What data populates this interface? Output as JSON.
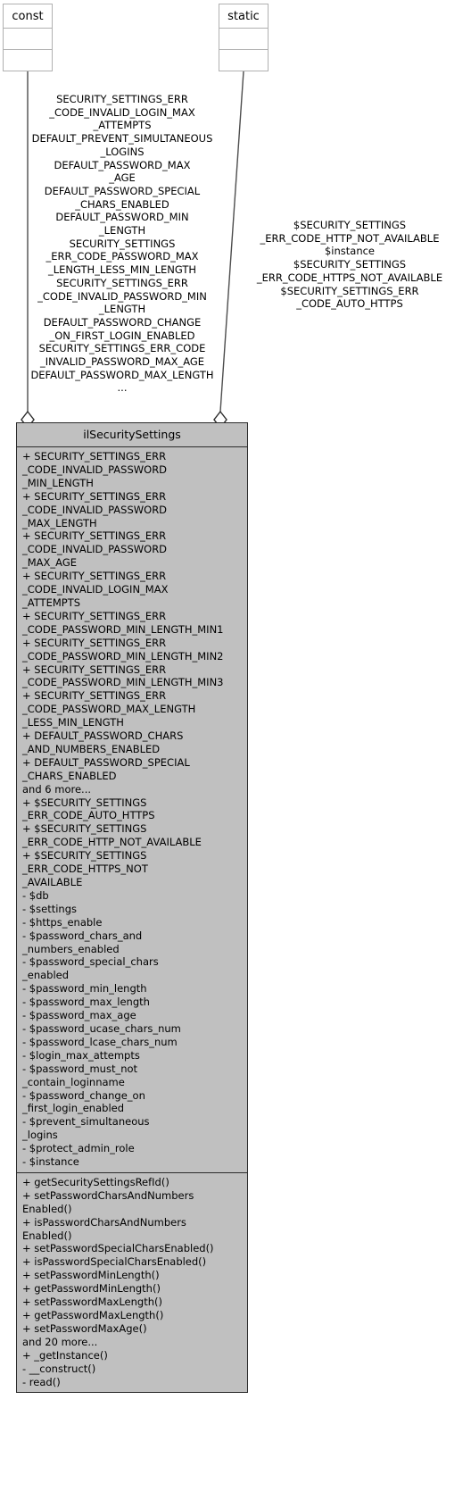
{
  "diagram": {
    "type": "uml-collaboration-diagram",
    "colors": {
      "class_fill": "#c0c0c0",
      "class_border": "#2b2b2b",
      "node_border": "#b0b0b0",
      "edge": "#4d4d4d",
      "background": "#ffffff"
    }
  },
  "nodes": {
    "const": {
      "title": "const"
    },
    "static": {
      "title": "static"
    }
  },
  "edges": {
    "const_to_class": {
      "label": "SECURITY_SETTINGS_ERR\n_CODE_INVALID_LOGIN_MAX\n_ATTEMPTS\nDEFAULT_PREVENT_SIMULTANEOUS\n_LOGINS\nDEFAULT_PASSWORD_MAX\n_AGE\nDEFAULT_PASSWORD_SPECIAL\n_CHARS_ENABLED\nDEFAULT_PASSWORD_MIN\n_LENGTH\nSECURITY_SETTINGS\n_ERR_CODE_PASSWORD_MAX\n_LENGTH_LESS_MIN_LENGTH\nSECURITY_SETTINGS_ERR\n_CODE_INVALID_PASSWORD_MIN\n_LENGTH\nDEFAULT_PASSWORD_CHANGE\n_ON_FIRST_LOGIN_ENABLED\nSECURITY_SETTINGS_ERR_CODE\n_INVALID_PASSWORD_MAX_AGE\nDEFAULT_PASSWORD_MAX_LENGTH\n..."
    },
    "static_to_class": {
      "label": "$SECURITY_SETTINGS\n_ERR_CODE_HTTP_NOT_AVAILABLE\n$instance\n$SECURITY_SETTINGS\n_ERR_CODE_HTTPS_NOT_AVAILABLE\n$SECURITY_SETTINGS_ERR\n_CODE_AUTO_HTTPS"
    }
  },
  "class": {
    "name": "ilSecuritySettings",
    "attributes": [
      "+ SECURITY_SETTINGS_ERR\n_CODE_INVALID_PASSWORD\n_MIN_LENGTH",
      "+ SECURITY_SETTINGS_ERR\n_CODE_INVALID_PASSWORD\n_MAX_LENGTH",
      "+ SECURITY_SETTINGS_ERR\n_CODE_INVALID_PASSWORD\n_MAX_AGE",
      "+ SECURITY_SETTINGS_ERR\n_CODE_INVALID_LOGIN_MAX\n_ATTEMPTS",
      "+ SECURITY_SETTINGS_ERR\n_CODE_PASSWORD_MIN_LENGTH_MIN1",
      "+ SECURITY_SETTINGS_ERR\n_CODE_PASSWORD_MIN_LENGTH_MIN2",
      "+ SECURITY_SETTINGS_ERR\n_CODE_PASSWORD_MIN_LENGTH_MIN3",
      "+ SECURITY_SETTINGS_ERR\n_CODE_PASSWORD_MAX_LENGTH\n_LESS_MIN_LENGTH",
      "+ DEFAULT_PASSWORD_CHARS\n_AND_NUMBERS_ENABLED",
      "+ DEFAULT_PASSWORD_SPECIAL\n_CHARS_ENABLED",
      "and 6 more...",
      "+ $SECURITY_SETTINGS\n_ERR_CODE_AUTO_HTTPS",
      "+ $SECURITY_SETTINGS\n_ERR_CODE_HTTP_NOT_AVAILABLE",
      "+ $SECURITY_SETTINGS\n_ERR_CODE_HTTPS_NOT\n_AVAILABLE",
      "- $db",
      "- $settings",
      "- $https_enable",
      "- $password_chars_and\n_numbers_enabled",
      "- $password_special_chars\n_enabled",
      "- $password_min_length",
      "- $password_max_length",
      "- $password_max_age",
      "- $password_ucase_chars_num",
      "- $password_lcase_chars_num",
      "- $login_max_attempts",
      "- $password_must_not\n_contain_loginname",
      "- $password_change_on\n_first_login_enabled",
      "- $prevent_simultaneous\n_logins",
      "- $protect_admin_role",
      "- $instance"
    ],
    "methods": [
      "+ getSecuritySettingsRefId()",
      "+ setPasswordCharsAndNumbers\nEnabled()",
      "+ isPasswordCharsAndNumbers\nEnabled()",
      "+ setPasswordSpecialCharsEnabled()",
      "+ isPasswordSpecialCharsEnabled()",
      "+ setPasswordMinLength()",
      "+ getPasswordMinLength()",
      "+ setPasswordMaxLength()",
      "+ getPasswordMaxLength()",
      "+ setPasswordMaxAge()",
      "and 20 more...",
      "+ _getInstance()",
      "- __construct()",
      "- read()"
    ]
  }
}
